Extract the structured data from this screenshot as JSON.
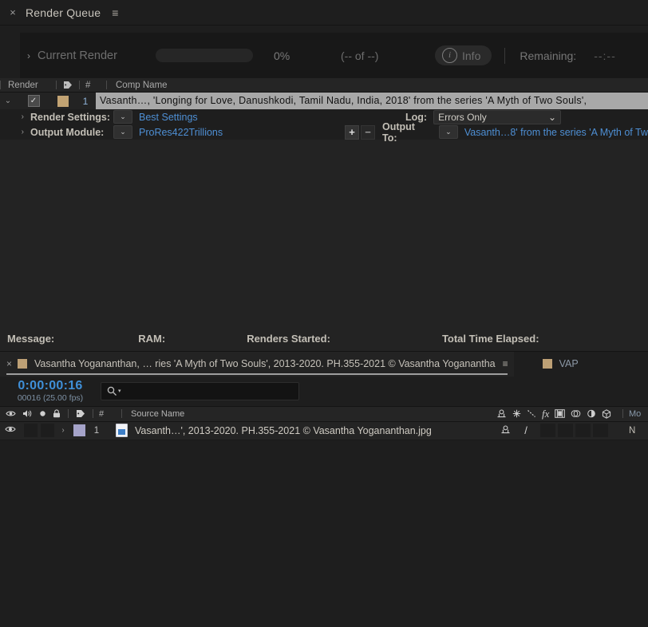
{
  "render_queue_panel": {
    "tab": {
      "close_icon": "×",
      "title": "Render Queue",
      "menu_icon": "≡"
    },
    "current_render": {
      "twirl_icon": "›",
      "label": "Current Render",
      "percent": "0%",
      "count": "(-- of --)",
      "info_icon": "i",
      "info_label": "Info",
      "remaining_label": "Remaining:",
      "remaining_value": "--:--"
    },
    "columns": {
      "render": "Render",
      "tag_icon": "tag-icon",
      "number": "#",
      "comp_name": "Comp Name"
    },
    "item": {
      "twirl_icon": "⌄",
      "checkbox_checked": "✓",
      "label_color": "#c2a373",
      "number": "1",
      "comp_name": "Vasanth…, 'Longing for Love, Danushkodi, Tamil Nadu, India, 2018' from the series 'A Myth of Two Souls',"
    },
    "render_settings": {
      "twirl_icon": "›",
      "label": "Render Settings:",
      "dropdown_icon": "⌄",
      "value": "Best Settings"
    },
    "log": {
      "label": "Log:",
      "value": "Errors Only",
      "dropdown_icon": "⌄"
    },
    "output_module": {
      "twirl_icon": "›",
      "label": "Output Module:",
      "dropdown_icon": "⌄",
      "value": "ProRes422Trillions",
      "add_icon": "+",
      "remove_icon": "−"
    },
    "output_to": {
      "label": "Output To:",
      "dropdown_icon": "⌄",
      "value": "Vasanth…8' from the series 'A Myth of Tw"
    },
    "status": {
      "message": "Message:",
      "ram": "RAM:",
      "renders_started": "Renders Started:",
      "total_time_elapsed": "Total Time Elapsed:"
    }
  },
  "timeline_panel": {
    "tabs": [
      {
        "close_icon": "×",
        "swatch_color": "#bda075",
        "name": "Vasantha Yogananthan, … ries 'A Myth of Two Souls', 2013-2020. PH.355-2021 © Vasantha Yoganantha",
        "menu_icon": "≡",
        "active": true
      },
      {
        "swatch_color": "#bda075",
        "name": "VAP",
        "active": false
      }
    ],
    "timecode": {
      "current": "0:00:00:16",
      "frames": "00016 (25.00 fps)"
    },
    "search": {
      "icon": "search-icon",
      "caret": "▾",
      "value": "",
      "placeholder": ""
    },
    "columns": {
      "video_icon": "eye-icon",
      "audio_icon": "speaker-icon",
      "solo_icon": "solo-dot-icon",
      "lock_icon": "lock-icon",
      "tag_icon": "tag-icon",
      "number": "#",
      "source_name": "Source Name",
      "switches": [
        "shy-icon",
        "collapse-icon",
        "quality-icon",
        "effects-icon",
        "frame-blend-icon",
        "motion-blur-icon",
        "adjustment-icon",
        "3d-layer-icon"
      ],
      "mode": "Mo"
    },
    "layer": {
      "eye_icon": "◉",
      "twirl_icon": "›",
      "label_color": "#a5a3c9",
      "number": "1",
      "source_name": "Vasanth…', 2013-2020. PH.355-2021 © Vasantha Yogananthan.jpg",
      "shy_icon": "shy-icon",
      "quality_icon": "/",
      "mode": "N"
    }
  }
}
